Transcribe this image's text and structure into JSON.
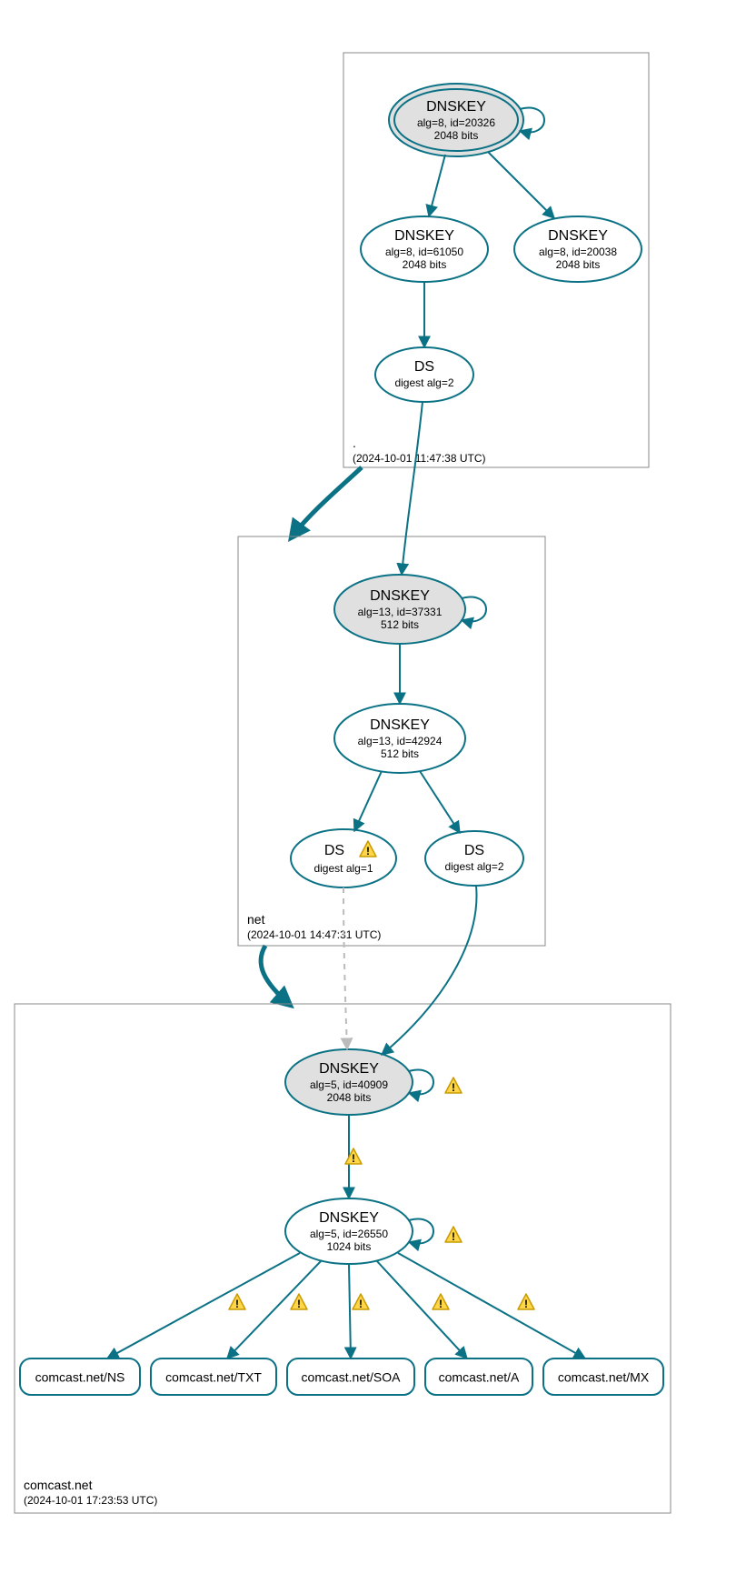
{
  "zones": {
    "root": {
      "label": ".",
      "timestamp": "(2024-10-01 11:47:38 UTC)"
    },
    "net": {
      "label": "net",
      "timestamp": "(2024-10-01 14:47:31 UTC)"
    },
    "comcast": {
      "label": "comcast.net",
      "timestamp": "(2024-10-01 17:23:53 UTC)"
    }
  },
  "nodes": {
    "root_ksk": {
      "title": "DNSKEY",
      "line2": "alg=8, id=20326",
      "line3": "2048 bits"
    },
    "root_zsk1": {
      "title": "DNSKEY",
      "line2": "alg=8, id=61050",
      "line3": "2048 bits"
    },
    "root_zsk2": {
      "title": "DNSKEY",
      "line2": "alg=8, id=20038",
      "line3": "2048 bits"
    },
    "root_ds": {
      "title": "DS",
      "line2": "digest alg=2"
    },
    "net_ksk": {
      "title": "DNSKEY",
      "line2": "alg=13, id=37331",
      "line3": "512 bits"
    },
    "net_zsk": {
      "title": "DNSKEY",
      "line2": "alg=13, id=42924",
      "line3": "512 bits"
    },
    "net_ds1": {
      "title": "DS",
      "line2": "digest alg=1"
    },
    "net_ds2": {
      "title": "DS",
      "line2": "digest alg=2"
    },
    "com_ksk": {
      "title": "DNSKEY",
      "line2": "alg=5, id=40909",
      "line3": "2048 bits"
    },
    "com_zsk": {
      "title": "DNSKEY",
      "line2": "alg=5, id=26550",
      "line3": "1024 bits"
    },
    "rr_ns": {
      "label": "comcast.net/NS"
    },
    "rr_txt": {
      "label": "comcast.net/TXT"
    },
    "rr_soa": {
      "label": "comcast.net/SOA"
    },
    "rr_a": {
      "label": "comcast.net/A"
    },
    "rr_mx": {
      "label": "comcast.net/MX"
    }
  }
}
